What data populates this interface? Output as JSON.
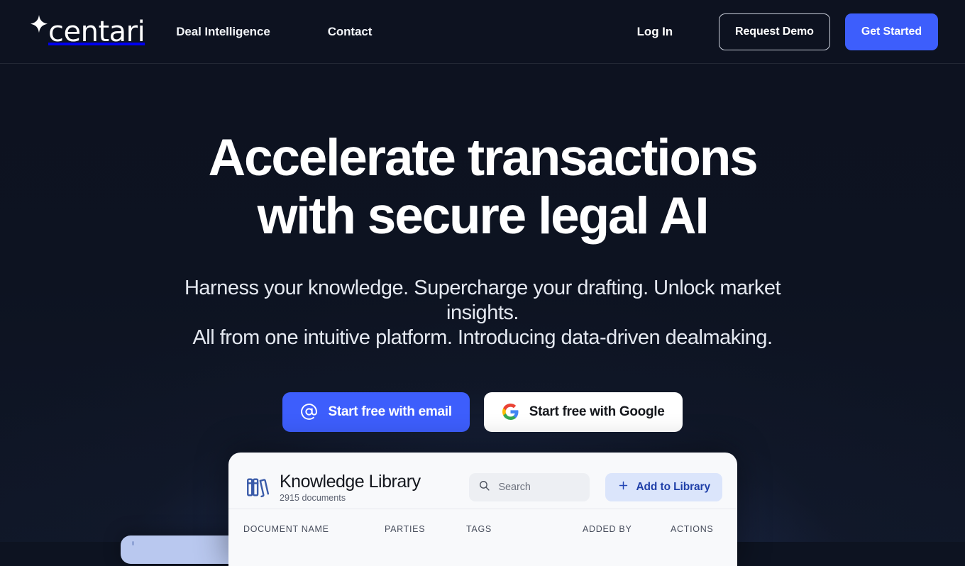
{
  "theme": {
    "background": "#0d1321",
    "accent_blue": "#3d5efc",
    "card_background": "#f8f9fb",
    "add_button_background": "#dbe5fb",
    "add_button_text": "#1f3fa8",
    "library_icon_blue": "#3a5ba9"
  },
  "header": {
    "brand": {
      "name": "centari",
      "icon": "sparkle-icon"
    },
    "nav_items": [
      {
        "label": "Deal Intelligence"
      },
      {
        "label": "Contact"
      }
    ],
    "login_label": "Log In",
    "request_demo_label": "Request Demo",
    "get_started_label": "Get Started"
  },
  "hero": {
    "headline_line1": "Accelerate transactions",
    "headline_line2": "with secure legal AI",
    "subhead_line1": "Harness your knowledge. Supercharge your drafting. Unlock market insights.",
    "subhead_line2": "All from one intuitive platform. Introducing data-driven dealmaking.",
    "cta_email": {
      "label": "Start free with email",
      "icon": "at-sign-icon"
    },
    "cta_google": {
      "label": "Start free with Google",
      "icon": "google-icon"
    }
  },
  "library": {
    "icon": "books-icon",
    "title": "Knowledge Library",
    "document_count": "2915 documents",
    "search": {
      "placeholder": "Search",
      "value": "",
      "icon": "search-icon"
    },
    "add_button": {
      "label": "Add to Library",
      "icon": "plus-icon"
    },
    "columns": [
      {
        "label": "DOCUMENT NAME"
      },
      {
        "label": "PARTIES"
      },
      {
        "label": "TAGS"
      },
      {
        "label": "ADDED BY"
      },
      {
        "label": "ACTIONS"
      }
    ]
  }
}
